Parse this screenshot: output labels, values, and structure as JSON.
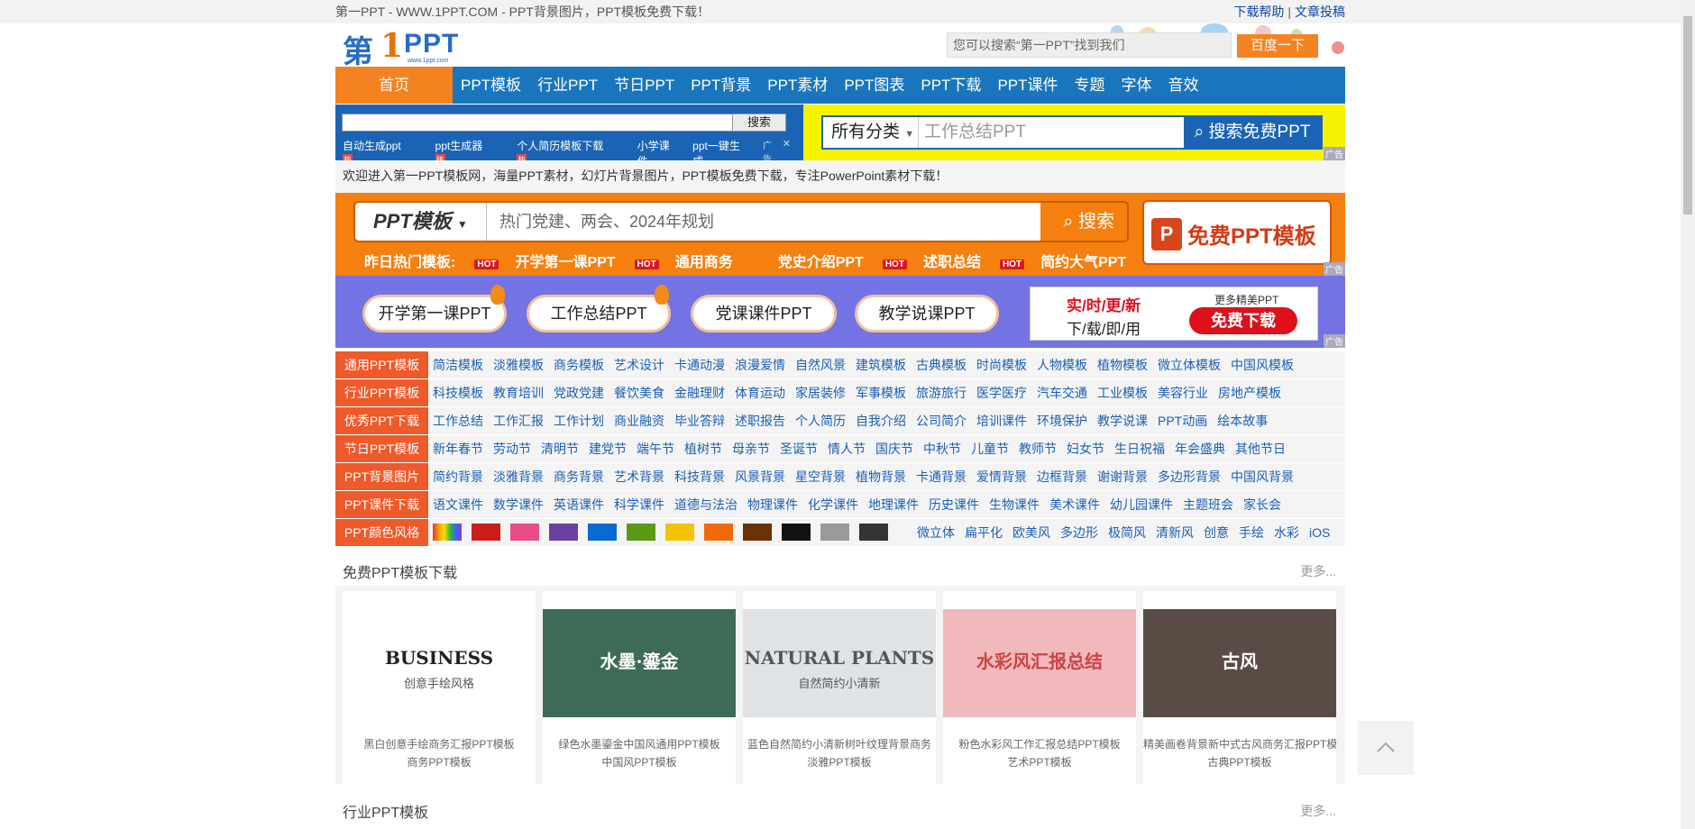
{
  "topbar": {
    "title": "第一PPT - WWW.1PPT.COM - PPT背景图片，PPT模板免费下载！",
    "help": "下载帮助",
    "contribute": "文章投稿"
  },
  "logo": {
    "part1": "第",
    "part2": "1",
    "part3": "PPT",
    "url": "www.1ppt.com"
  },
  "header_search": {
    "placeholder": "您可以搜索“第一PPT”找到我们",
    "button": "百度一下"
  },
  "nav": {
    "home": "首页",
    "items": [
      "PPT模板",
      "行业PPT",
      "节日PPT",
      "PPT背景",
      "PPT素材",
      "PPT图表",
      "PPT下载",
      "PPT课件",
      "专题",
      "字体",
      "音效"
    ]
  },
  "ad_search": {
    "button": "搜索",
    "links": [
      {
        "text": "自动生成ppt",
        "hot": "热"
      },
      {
        "text": "ppt生成器",
        "hot": "热"
      },
      {
        "text": "个人简历模板下载",
        "hot": "热"
      },
      {
        "text": "小学课件",
        "hot": ""
      },
      {
        "text": "ppt一键生成",
        "hot": ""
      }
    ],
    "ad_label": "广告",
    "close": "✕"
  },
  "yellow_search": {
    "category": "所有分类",
    "keyword": "工作总结PPT",
    "button": "搜索免费PPT",
    "ad": "广告"
  },
  "welcome": "欢迎进入第一PPT模板网，海量PPT素材，幻灯片背景图片，PPT模板免费下载，专注PowerPoint素材下载！",
  "orange": {
    "category": "PPT模板",
    "placeholder": "热门党建、两会、2024年规划",
    "button": "搜索",
    "free": "免费PPT模板",
    "free_icon": "P",
    "hot_label": "HOT",
    "hot": [
      {
        "text": "昨日热门模板:",
        "hot": true
      },
      {
        "text": "开学第一课PPT",
        "hot": true
      },
      {
        "text": "通用商务",
        "hot": false
      },
      {
        "text": "党史介绍PPT",
        "hot": true
      },
      {
        "text": "述职总结",
        "hot": true
      },
      {
        "text": "简约大气PPT",
        "hot": false
      }
    ]
  },
  "purple": {
    "pills": [
      "开学第一课PPT",
      "工作总结PPT",
      "党课课件PPT",
      "教学说课PPT"
    ],
    "dl_line1": "实/时/更/新",
    "dl_line2": "下/载/即/用",
    "dl_more": "更多精美PPT",
    "dl_button": "免费下载"
  },
  "categories": [
    {
      "label": "通用PPT模板",
      "items": [
        "简洁模板",
        "淡雅模板",
        "商务模板",
        "艺术设计",
        "卡通动漫",
        "浪漫爱情",
        "自然风景",
        "建筑模板",
        "古典模板",
        "时尚模板",
        "人物模板",
        "植物模板",
        "微立体模板",
        "中国风模板"
      ]
    },
    {
      "label": "行业PPT模板",
      "items": [
        "科技模板",
        "教育培训",
        "党政党建",
        "餐饮美食",
        "金融理财",
        "体育运动",
        "家居装修",
        "军事模板",
        "旅游旅行",
        "医学医疗",
        "汽车交通",
        "工业模板",
        "美容行业",
        "房地产模板"
      ]
    },
    {
      "label": "优秀PPT下载",
      "items": [
        "工作总结",
        "工作汇报",
        "工作计划",
        "商业融资",
        "毕业答辩",
        "述职报告",
        "个人简历",
        "自我介绍",
        "公司简介",
        "培训课件",
        "环境保护",
        "教学说课",
        "PPT动画",
        "绘本故事"
      ]
    },
    {
      "label": "节日PPT模板",
      "items": [
        "新年春节",
        "劳动节",
        "清明节",
        "建党节",
        "端午节",
        "植树节",
        "母亲节",
        "圣诞节",
        "情人节",
        "国庆节",
        "中秋节",
        "儿童节",
        "教师节",
        "妇女节",
        "生日祝福",
        "年会盛典",
        "其他节日"
      ]
    },
    {
      "label": "PPT背景图片",
      "items": [
        "简约背景",
        "淡雅背景",
        "商务背景",
        "艺术背景",
        "科技背景",
        "风景背景",
        "星空背景",
        "植物背景",
        "卡通背景",
        "爱情背景",
        "边框背景",
        "谢谢背景",
        "多边形背景",
        "中国风背景"
      ]
    },
    {
      "label": "PPT课件下载",
      "items": [
        "语文课件",
        "数学课件",
        "英语课件",
        "科学课件",
        "道德与法治",
        "物理课件",
        "化学课件",
        "地理课件",
        "历史课件",
        "生物课件",
        "美术课件",
        "幼儿园课件",
        "主题班会",
        "家长会"
      ]
    },
    {
      "label": "PPT颜色风格",
      "colors": [
        "#ea4335",
        "#cc1d1d",
        "#e84d8a",
        "#6b3fa0",
        "#0b6ad1",
        "#5a9a16",
        "#f5c200",
        "#f06a0a",
        "#6b3208",
        "#111111",
        "#9a9a9a",
        "#333333"
      ],
      "items": [
        "微立体",
        "扁平化",
        "欧美风",
        "多边形",
        "极简风",
        "清新风",
        "创意",
        "手绘",
        "水彩",
        "iOS"
      ]
    }
  ],
  "free_section": {
    "title": "免费PPT模板下载",
    "more": "更多...",
    "cards": [
      {
        "line1": "黑白创意手绘商务汇报PPT模板",
        "line2": "商务PPT模板",
        "img_text": "BUSINESS",
        "img_sub": "创意手绘风格",
        "bg": "#ffffff"
      },
      {
        "line1": "绿色水墨鎏金中国风通用PPT模板",
        "line2": "中国风PPT模板",
        "img_text": "水墨·鎏金",
        "img_sub": "",
        "bg": "#3e6b57"
      },
      {
        "line1": "蓝色自然简约小清新树叶纹理背景商务",
        "line2": "淡雅PPT模板",
        "img_text": "NATURAL PLANTS",
        "img_sub": "自然简约小清新",
        "bg": "#dfe3e6"
      },
      {
        "line1": "粉色水彩风工作汇报总结PPT模板",
        "line2": "艺术PPT模板",
        "img_text": "水彩风汇报总结",
        "img_sub": "",
        "bg": "#f2b9bd"
      },
      {
        "line1": "精美画卷背景新中式古风商务汇报PPT模",
        "line2": "古典PPT模板",
        "img_text": "古风",
        "img_sub": "",
        "bg": "#5b4b45"
      }
    ]
  },
  "industry_section": {
    "title": "行业PPT模板",
    "more": "更多..."
  },
  "back_top": "^"
}
